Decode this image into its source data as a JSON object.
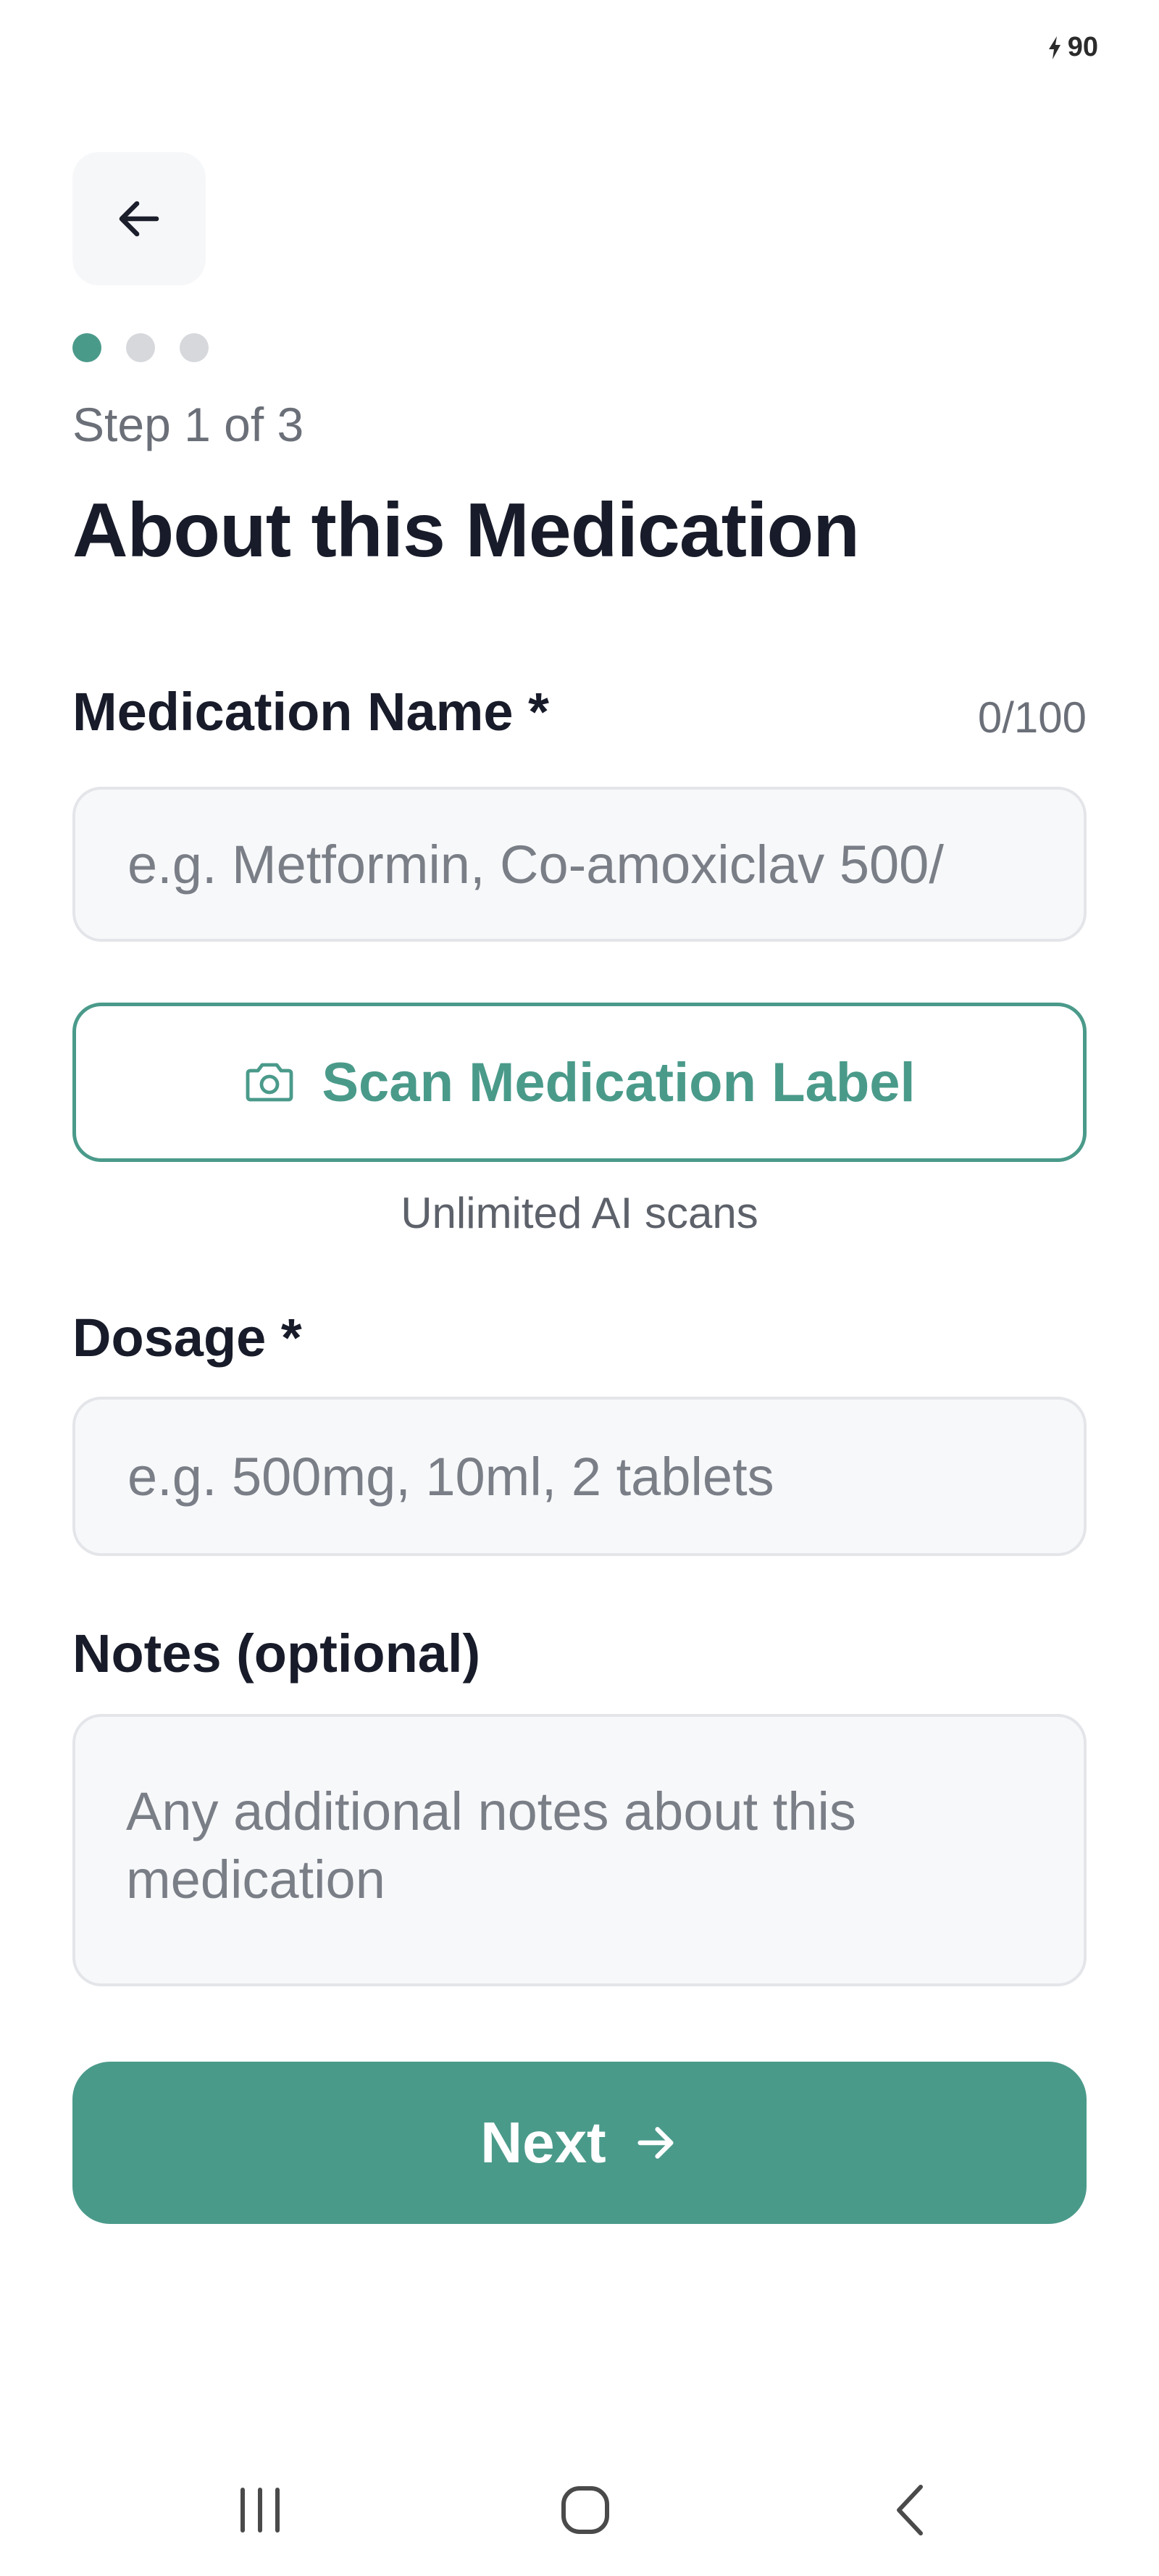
{
  "status": {
    "battery": "90",
    "battery_icon": "charging-bolt-icon"
  },
  "header": {
    "back_icon": "arrow-left-icon",
    "progress": {
      "current": 1,
      "total": 3
    },
    "step_label": "Step 1 of 3",
    "title": "About this Medication"
  },
  "form": {
    "medication_name": {
      "label": "Medication Name *",
      "counter": "0/100",
      "value": "",
      "placeholder": "e.g. Metformin, Co-amoxiclav 500/"
    },
    "scan": {
      "icon": "camera-icon",
      "label": "Scan Medication Label",
      "note": "Unlimited AI scans"
    },
    "dosage": {
      "label": "Dosage *",
      "value": "",
      "placeholder": "e.g. 500mg, 10ml, 2 tablets"
    },
    "notes": {
      "label": "Notes (optional)",
      "value": "",
      "placeholder": "Any additional notes about this medication"
    }
  },
  "actions": {
    "next_label": "Next",
    "next_icon": "arrow-right-icon"
  },
  "system_nav": {
    "recents_icon": "recent-apps-icon",
    "home_icon": "home-icon",
    "back_icon": "back-chevron-icon"
  },
  "colors": {
    "accent": "#4a9a8a",
    "inactive_dot": "#d6d8dc",
    "input_bg": "#f7f8fa",
    "title": "#181b29"
  }
}
